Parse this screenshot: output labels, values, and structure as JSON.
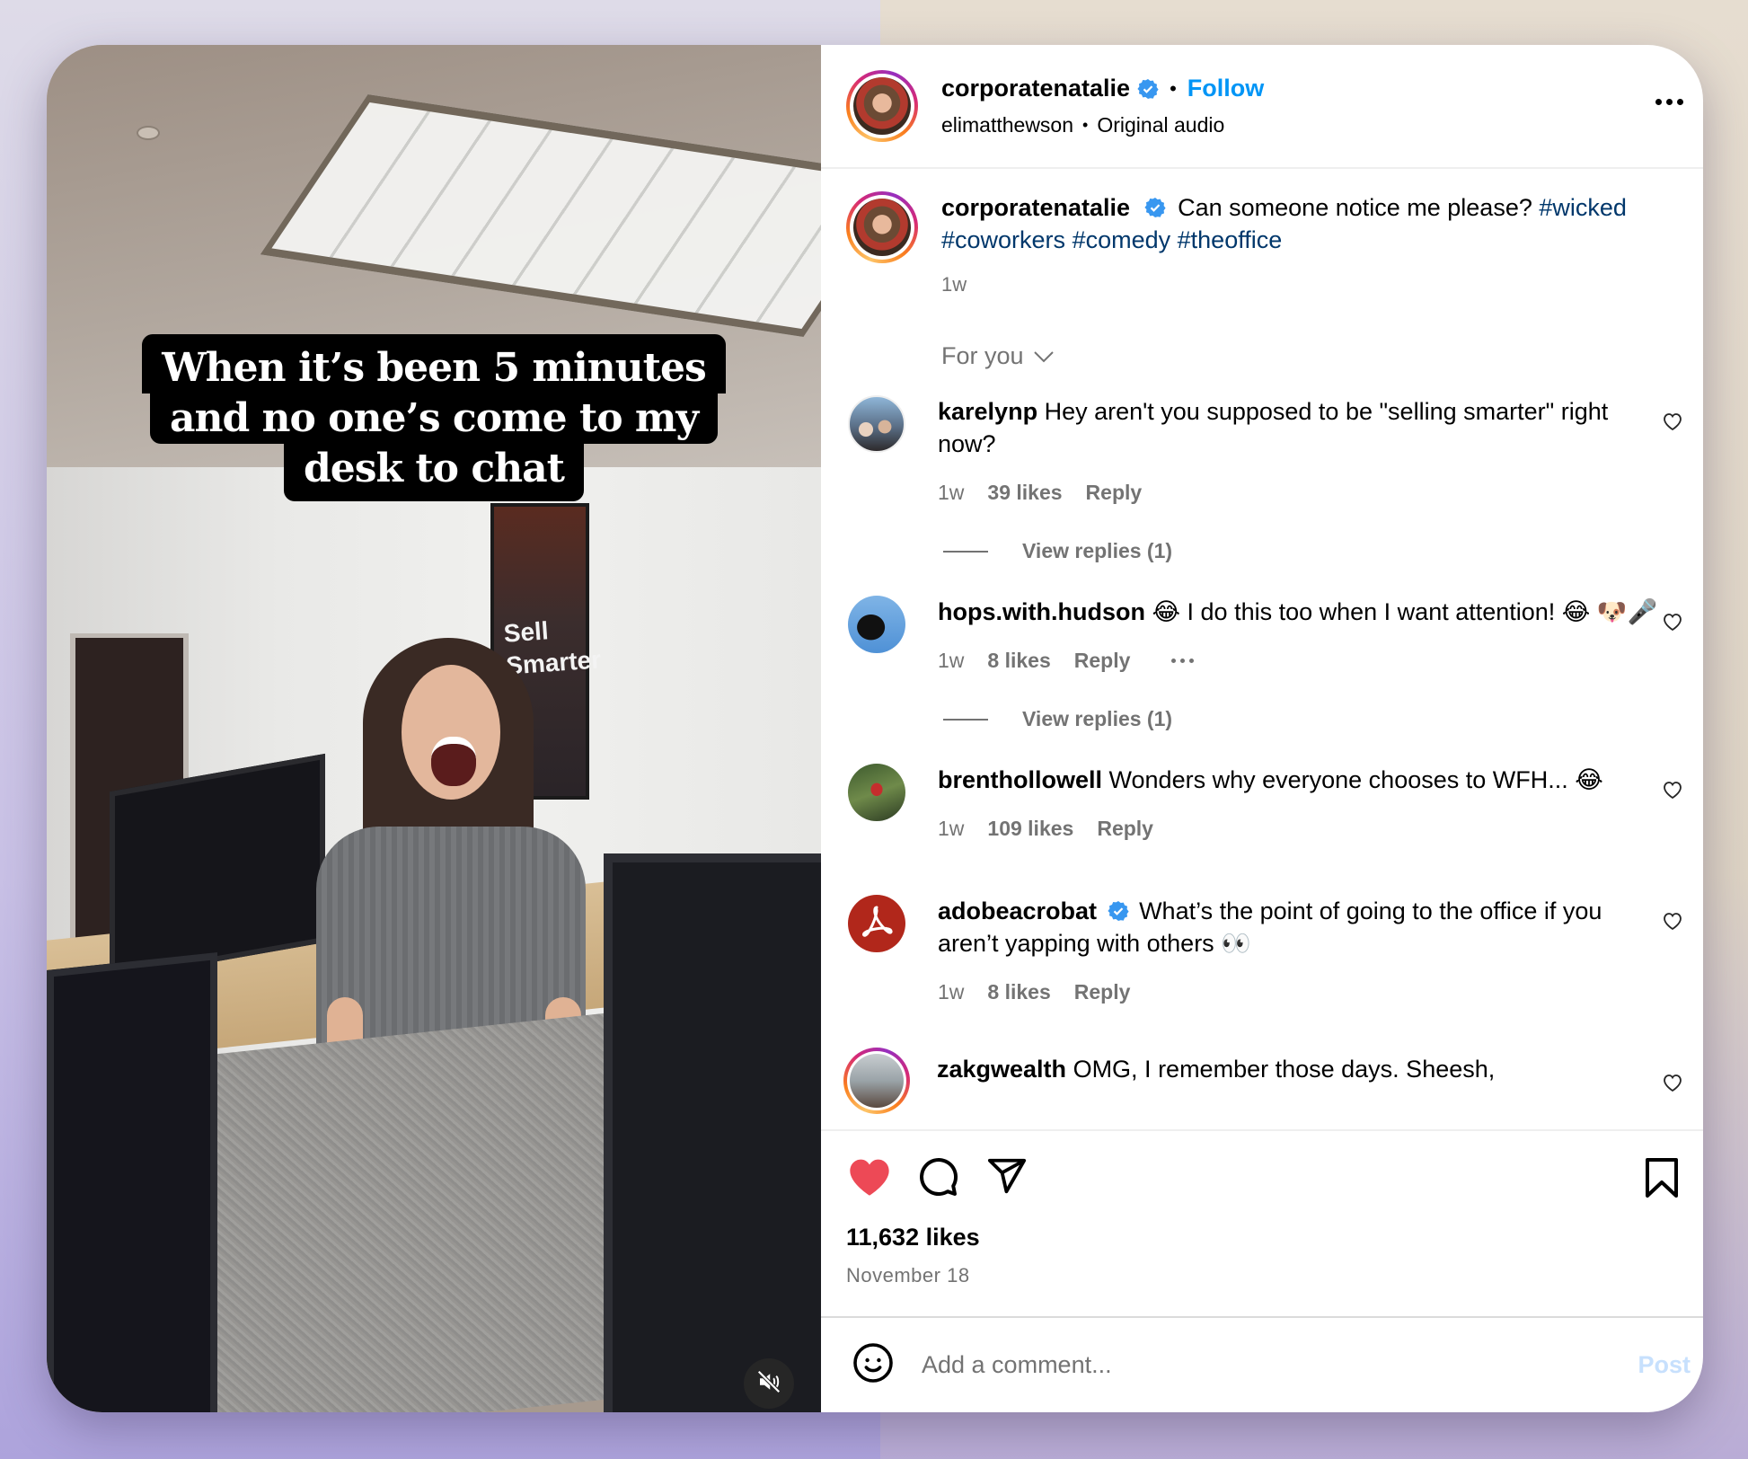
{
  "video": {
    "overlay_caption": [
      "When it’s been 5 minutes",
      "and no one’s come to my",
      "desk to chat"
    ],
    "poster_text": [
      "Sell",
      "Smarter"
    ],
    "mute_icon": "speaker-muted-icon"
  },
  "header": {
    "username": "corporatenatalie",
    "verified": true,
    "separator": "•",
    "follow_label": "Follow",
    "audio_author": "elimatthewson",
    "audio_separator": "•",
    "audio_label": "Original audio",
    "more_icon": "more-horizontal-icon"
  },
  "caption": {
    "username": "corporatenatalie",
    "text": "Can someone notice me please?",
    "hashtags": [
      "#wicked",
      "#coworkers",
      "#comedy",
      "#theoffice"
    ],
    "time": "1w"
  },
  "sort": {
    "label": "For you",
    "icon": "chevron-down-icon"
  },
  "comments": [
    {
      "username": "karelynp",
      "verified": false,
      "text": "Hey aren't you supposed to be \"selling smarter\" right now?",
      "time": "1w",
      "likes": "39 likes",
      "reply_label": "Reply",
      "view_replies": "View replies (1)"
    },
    {
      "username": "hops.with.hudson",
      "verified": false,
      "text": "😂 I do this too when I want attention! 😂 🐶🎤",
      "time": "1w",
      "likes": "8 likes",
      "reply_label": "Reply",
      "has_more": true,
      "view_replies": "View replies (1)"
    },
    {
      "username": "brenthollowell",
      "verified": false,
      "text": "Wonders why everyone chooses to WFH... 😂",
      "time": "1w",
      "likes": "109 likes",
      "reply_label": "Reply"
    },
    {
      "username": "adobeacrobat",
      "verified": true,
      "text": "What’s the point of going to the office if you aren’t yapping with others 👀",
      "time": "1w",
      "likes": "8 likes",
      "reply_label": "Reply"
    },
    {
      "username": "zakgwealth",
      "verified": false,
      "text": "OMG, I remember those days. Sheesh,"
    }
  ],
  "actions": {
    "liked": true,
    "like_icon": "heart-filled-icon",
    "comment_icon": "comment-bubble-icon",
    "share_icon": "send-paper-plane-icon",
    "save_icon": "bookmark-icon",
    "likes_count": "11,632 likes",
    "date": "November 18"
  },
  "add_comment": {
    "emoji_icon": "smiley-icon",
    "placeholder": "Add a comment...",
    "value": "",
    "post_label": "Post"
  },
  "colors": {
    "follow": "#0095f6",
    "hashtag": "#00376b",
    "like_red": "#ed4956",
    "muted_text": "#737373",
    "post_disabled": "#c7e0fd",
    "verified": "#3897f0"
  }
}
